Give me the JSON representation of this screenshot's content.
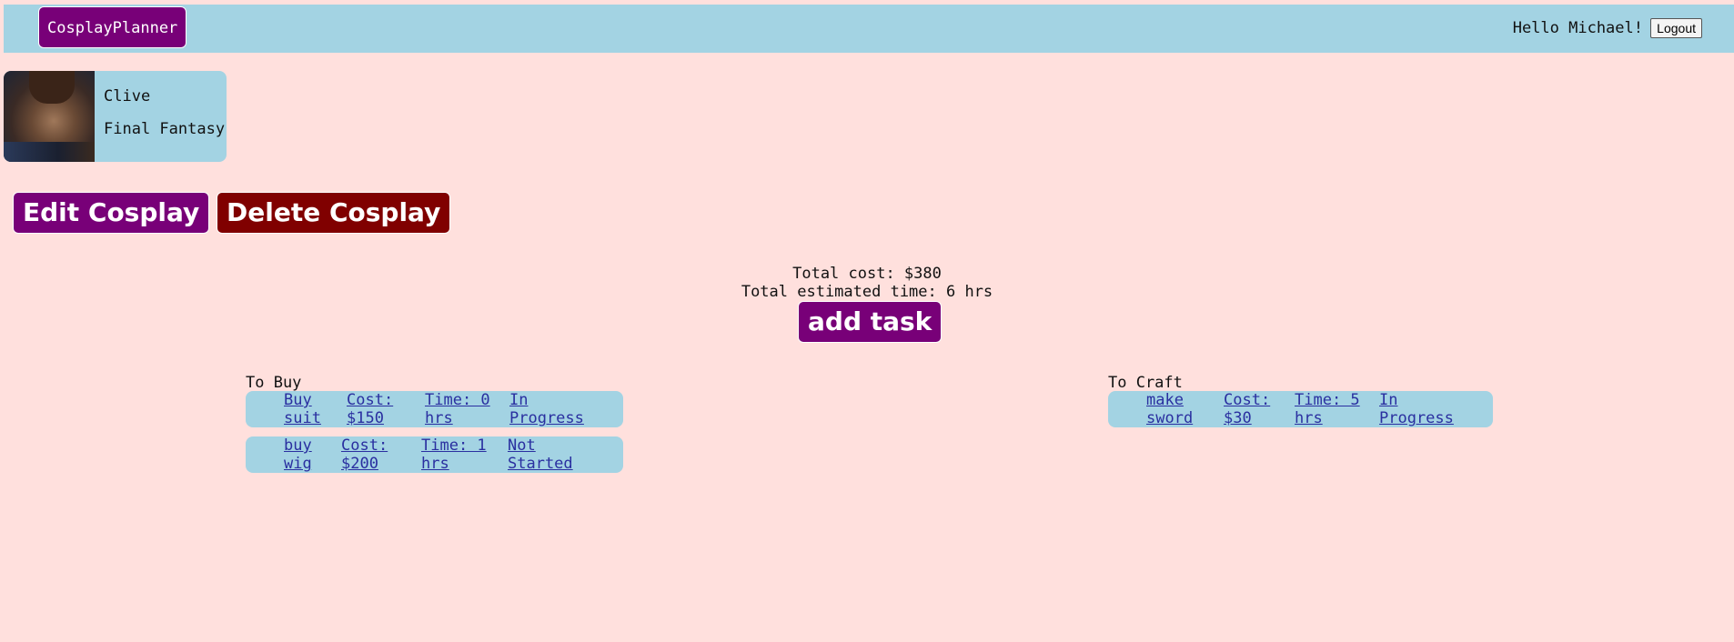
{
  "navbar": {
    "brand": "CosplayPlanner",
    "greeting": "Hello Michael!",
    "logout_label": "Logout"
  },
  "cosplay": {
    "character": "Clive",
    "series": "Final Fantasy"
  },
  "actions": {
    "edit_label": "Edit Cosplay",
    "delete_label": "Delete Cosplay",
    "add_task_label": "add task"
  },
  "totals": {
    "cost": "Total cost: $380",
    "time": "Total estimated time: 6 hrs"
  },
  "to_buy": {
    "title": "To Buy",
    "tasks": [
      {
        "name": "Buy suit",
        "cost": "Cost: $150",
        "time": "Time: 0 hrs",
        "status": "In Progress"
      },
      {
        "name": "buy wig",
        "cost": "Cost: $200",
        "time": "Time: 1 hrs",
        "status": "Not Started"
      }
    ]
  },
  "to_craft": {
    "title": "To Craft",
    "tasks": [
      {
        "name": "make sword",
        "cost": "Cost: $30",
        "time": "Time: 5 hrs",
        "status": "In Progress"
      }
    ]
  }
}
